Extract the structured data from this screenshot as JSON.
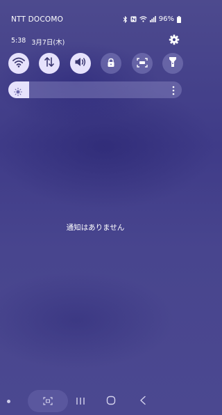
{
  "status_bar": {
    "carrier": "NTT DOCOMO",
    "battery_percent": "96%",
    "icons": [
      "bluetooth-icon",
      "nfc-icon",
      "wifi-icon",
      "signal-icon",
      "battery-icon"
    ]
  },
  "header": {
    "time": "5:38",
    "date": "3月7日(木)",
    "settings_icon": "gear-icon"
  },
  "quick_settings": {
    "tiles": [
      {
        "icon": "wifi-icon",
        "state": "on"
      },
      {
        "icon": "mobile-data-icon",
        "state": "on"
      },
      {
        "icon": "sound-icon",
        "state": "on"
      },
      {
        "icon": "secure-folder-icon",
        "state": "off"
      },
      {
        "icon": "screen-capture-icon",
        "state": "off"
      },
      {
        "icon": "flashlight-icon",
        "state": "off"
      }
    ],
    "brightness_level": 0.12
  },
  "notifications": {
    "empty_text": "通知はありません"
  },
  "nav_bar": {
    "icons": [
      "dot-indicator-icon",
      "media-output-icon",
      "recent-apps-icon",
      "home-icon",
      "back-icon"
    ]
  },
  "colors": {
    "background": "#433f8a",
    "tile_on": "#e6e2fc",
    "tile_off": "#7f7cbd"
  }
}
